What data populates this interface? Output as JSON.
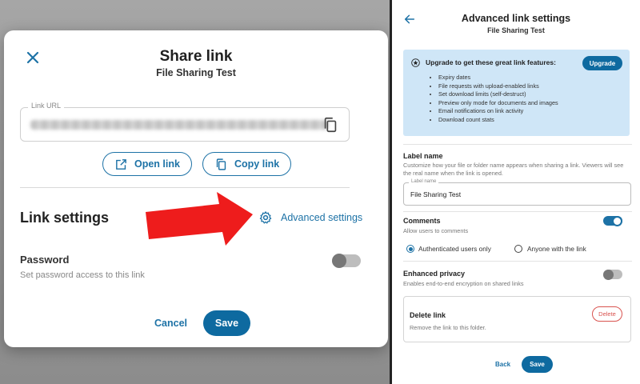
{
  "share_dialog": {
    "title": "Share link",
    "subtitle": "File Sharing Test",
    "link_url_label": "Link URL",
    "open_link_label": "Open link",
    "copy_link_label": "Copy link",
    "link_settings_title": "Link settings",
    "advanced_settings_label": "Advanced settings",
    "password_title": "Password",
    "password_desc": "Set password access to this link",
    "password_enabled": false,
    "cancel_label": "Cancel",
    "save_label": "Save"
  },
  "advanced_panel": {
    "title": "Advanced link settings",
    "subtitle": "File Sharing Test",
    "upgrade": {
      "heading": "Upgrade to get these great link features:",
      "button_label": "Upgrade",
      "features": [
        "Expiry dates",
        "File requests with upload-enabled links",
        "Set download limits (self-destruct)",
        "Preview only mode for documents and images",
        "Email notifications on link activity",
        "Download count stats"
      ]
    },
    "label_name": {
      "title": "Label name",
      "desc": "Customize how your file or folder name appears when sharing a link. Viewers will see the real name when the link is opened.",
      "field_legend": "Label name",
      "field_value": "File Sharing Test"
    },
    "comments": {
      "title": "Comments",
      "desc": "Allow users to comments",
      "enabled": true,
      "options": [
        "Authenticated users only",
        "Anyone with the link"
      ],
      "selected": "Authenticated users only"
    },
    "enhanced_privacy": {
      "title": "Enhanced privacy",
      "desc": "Enables end-to-end encryption on shared links",
      "enabled": false
    },
    "delete_link": {
      "title": "Delete link",
      "desc": "Remove the link to this folder.",
      "button_label": "Delete"
    },
    "back_label": "Back",
    "save_label": "Save"
  },
  "colors": {
    "accent": "#1d72a6",
    "primary_button": "#0e6aa0",
    "upgrade_bg": "#cfe6f7",
    "delete_red": "#d9534f",
    "annotation_arrow": "#ee1c1c"
  }
}
